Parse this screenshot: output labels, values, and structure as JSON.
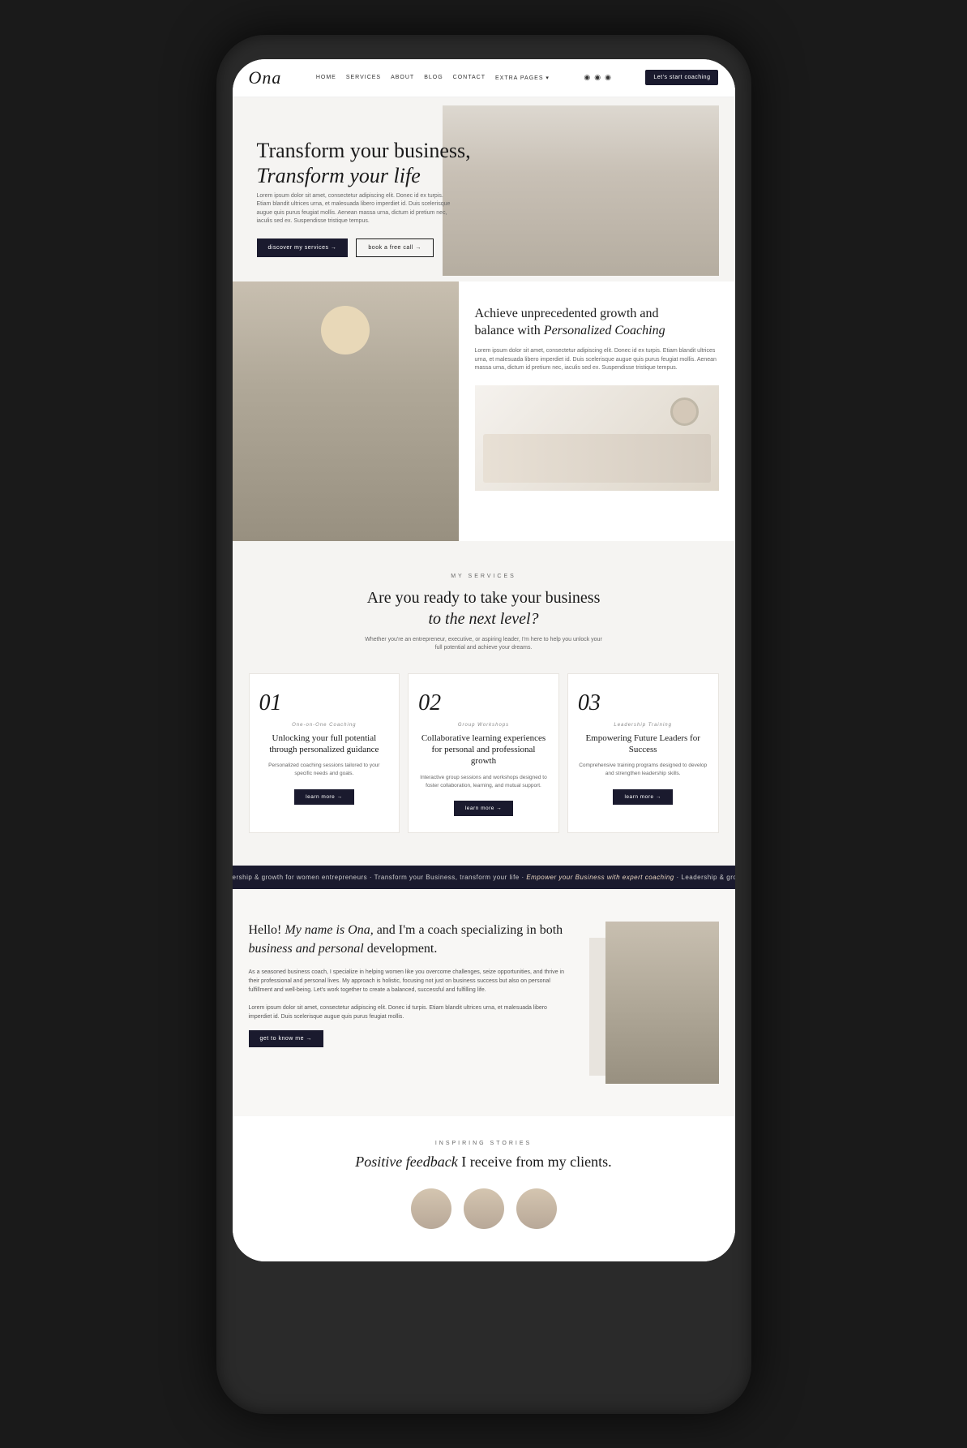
{
  "brand": {
    "logo": "Ona"
  },
  "navbar": {
    "links": [
      {
        "label": "HOME",
        "href": "#"
      },
      {
        "label": "SERVICES",
        "href": "#"
      },
      {
        "label": "ABOUT",
        "href": "#"
      },
      {
        "label": "BLOG",
        "href": "#"
      },
      {
        "label": "CONTACT",
        "href": "#"
      },
      {
        "label": "EXTRA PAGES ▾",
        "href": "#"
      }
    ],
    "cta": "Let's start coaching"
  },
  "hero": {
    "title_line1": "Transform your business,",
    "title_line2": "Transform your life",
    "body": "Lorem ipsum dolor sit amet, consectetur adipiscing elit. Donec id ex turpis. Etiam blandit ultrices urna, et malesuada libero imperdiet id. Duis scelerisque augue quis purus feugiat mollis. Aenean massa urna, dictum id pretium nec, iaculis sed ex. Suspendisse tristique tempus.",
    "btn1": "discover my services →",
    "btn2": "book a free call →"
  },
  "coaching": {
    "title_line1": "Achieve unprecedented growth and",
    "title_line2": "balance with",
    "title_italic": "Personalized Coaching",
    "body": "Lorem ipsum dolor sit amet, consectetur adipiscing elit. Donec id ex turpis. Etiam blandit ultrices urna, et malesuada libero imperdiet id. Duis scelerisque augue quis purus feugiat mollis. Aenean massa urna, dictum id pretium nec, iaculis sed ex. Suspendisse tristique tempus."
  },
  "services": {
    "section_label": "MY SERVICES",
    "title_line1": "Are you ready to take your business",
    "title_line2": "to the next level?",
    "subtitle": "Whether you're an entrepreneur, executive, or aspiring leader, I'm here to help you unlock your full potential and achieve your dreams.",
    "cards": [
      {
        "num": "01",
        "type": "One-on-One Coaching",
        "title": "Unlocking your full potential through personalized guidance",
        "desc": "Personalized coaching sessions tailored to your specific needs and goals.",
        "btn": "learn more →"
      },
      {
        "num": "02",
        "type": "Group Workshops",
        "title": "Collaborative learning experiences for personal and professional growth",
        "desc": "Interactive group sessions and workshops designed to foster collaboration, learning, and mutual support.",
        "btn": "learn more →"
      },
      {
        "num": "03",
        "type": "Leadership Training",
        "title": "Empowering Future Leaders for Success",
        "desc": "Comprehensive training programs designed to develop and strengthen leadership skills.",
        "btn": "learn more →"
      }
    ]
  },
  "marquee": {
    "text": "ership & growth for women entrepreneurs · Transform your Business, transform your life · Empower your Business with expert coaching · Leadership & growth for women entrepreneurs"
  },
  "about": {
    "title_part1": "Hello! My name is Ona,",
    "title_part2": "and I'm a coach specializing in both",
    "title_italic": "business and personal",
    "title_part3": "development.",
    "body1": "As a seasoned business coach, I specialize in helping women like you overcome challenges, seize opportunities, and thrive in their professional and personal lives. My approach is holistic, focusing not just on business success but also on personal fulfillment and well-being. Let's work together to create a balanced, successful and fulfilling life.",
    "body2": "Lorem ipsum dolor sit amet, consectetur adipiscing elit. Donec id turpis. Etiam blandit ultrices urna, et malesuada libero imperdiet id. Duis scelerisque augue quis purus feugiat mollis.",
    "btn": "get to know me →"
  },
  "testimonials": {
    "section_label": "INSPIRING STORIES",
    "title_part1": "Positive feedback",
    "title_part2": "I receive from my clients."
  }
}
